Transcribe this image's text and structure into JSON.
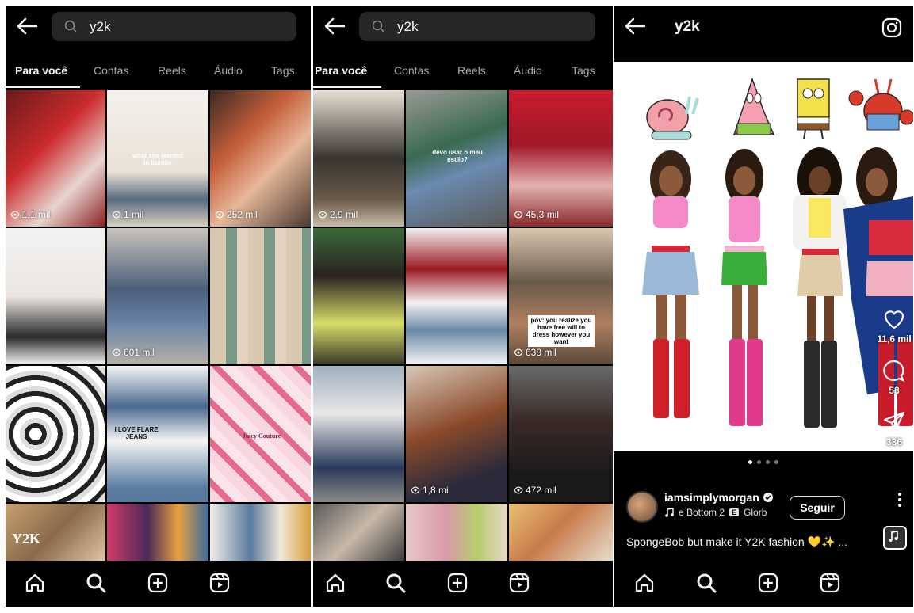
{
  "search": {
    "query": "y2k"
  },
  "tabs": [
    "Para você",
    "Contas",
    "Reels",
    "Áudio",
    "Tags"
  ],
  "panel1": {
    "view_counts": [
      "1,1 mil",
      "1 mil",
      "252 mil",
      "601 mil"
    ]
  },
  "panel2": {
    "view_counts": [
      "2,9 mil",
      "45,3 mil",
      "638 mil",
      "1,8 mi",
      "472 mil"
    ],
    "captions": [
      "devo usar o meu estilo?",
      "pov: you realize you have free will to dress however you want"
    ]
  },
  "panel1_captions": [
    "what she wanted in bundle",
    "I LOVE FLARE JEANS",
    "Juicy Couture",
    "Y2K"
  ],
  "post": {
    "title": "y2k",
    "likes": "11,6 mil",
    "comments": "58",
    "shares": "336",
    "username": "iamsimplymorgan",
    "audio": "e Bottom 2",
    "audio_badge": "E",
    "audio_artist": "Glorb",
    "follow_label": "Seguir",
    "caption": "SpongeBob but make it Y2K fashion 💛✨ ...",
    "carousel_count": 4
  },
  "nav_icons": [
    "home-icon",
    "search-icon",
    "create-icon",
    "reels-icon"
  ],
  "colors": {
    "background": "#000000",
    "search_bg": "#262626",
    "text": "#f5f5f5",
    "muted": "#a8a8a8"
  }
}
